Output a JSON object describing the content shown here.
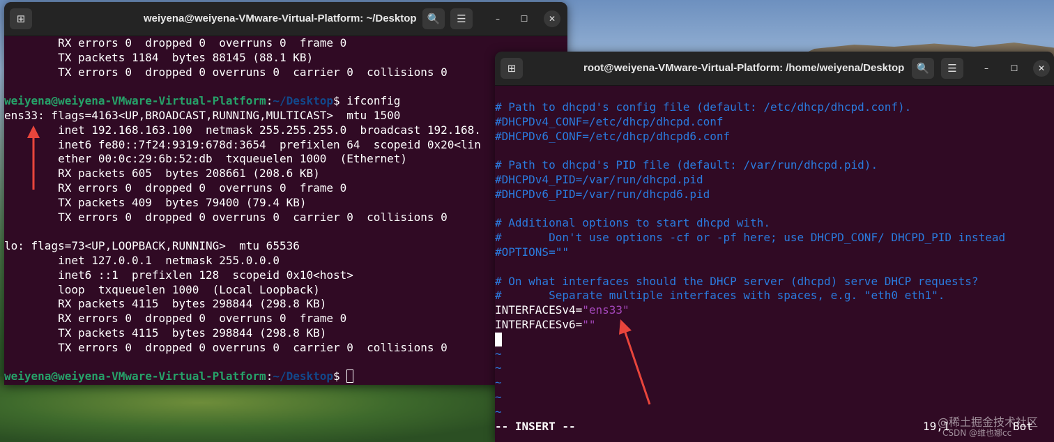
{
  "terminal_left": {
    "title": "weiyena@weiyena-VMware-Virtual-Platform: ~/Desktop",
    "buttons": {
      "new_tab": "⊞",
      "search": "🔍",
      "menu": "☰",
      "minimize": "–",
      "maximize": "☐",
      "close": "✕"
    },
    "lines": [
      "        RX errors 0  dropped 0  overruns 0  frame 0",
      "        TX packets 1184  bytes 88145 (88.1 KB)",
      "        TX errors 0  dropped 0 overruns 0  carrier 0  collisions 0",
      "",
      "__PROMPT1__",
      "ens33: flags=4163<UP,BROADCAST,RUNNING,MULTICAST>  mtu 1500",
      "        inet 192.168.163.100  netmask 255.255.255.0  broadcast 192.168.",
      "        inet6 fe80::7f24:9319:678d:3654  prefixlen 64  scopeid 0x20<lin",
      "        ether 00:0c:29:6b:52:db  txqueuelen 1000  (Ethernet)",
      "        RX packets 605  bytes 208661 (208.6 KB)",
      "        RX errors 0  dropped 0  overruns 0  frame 0",
      "        TX packets 409  bytes 79400 (79.4 KB)",
      "        TX errors 0  dropped 0 overruns 0  carrier 0  collisions 0",
      "",
      "lo: flags=73<UP,LOOPBACK,RUNNING>  mtu 65536",
      "        inet 127.0.0.1  netmask 255.0.0.0",
      "        inet6 ::1  prefixlen 128  scopeid 0x10<host>",
      "        loop  txqueuelen 1000  (Local Loopback)",
      "        RX packets 4115  bytes 298844 (298.8 KB)",
      "        RX errors 0  dropped 0  overruns 0  frame 0",
      "        TX packets 4115  bytes 298844 (298.8 KB)",
      "        TX errors 0  dropped 0 overruns 0  carrier 0  collisions 0"
    ],
    "prompt": {
      "user_host": "weiyena@weiyena-VMware-Virtual-Platform",
      "colon": ":",
      "path": "~/Desktop",
      "dollar": "$",
      "command": " ifconfig"
    }
  },
  "terminal_right": {
    "title": "root@weiyena-VMware-Virtual-Platform: /home/weiyena/Desktop",
    "buttons": {
      "new_tab": "⊞",
      "search": "🔍",
      "menu": "☰",
      "minimize": "–",
      "maximize": "☐",
      "close": "✕"
    },
    "lines": [
      {
        "t": "# Path to dhcpd's config file (default: /etc/dhcp/dhcpd.conf).",
        "c": "cmt"
      },
      {
        "t": "#DHCPDv4_CONF=/etc/dhcp/dhcpd.conf",
        "c": "cmt"
      },
      {
        "t": "#DHCPDv6_CONF=/etc/dhcp/dhcpd6.conf",
        "c": "cmt"
      },
      {
        "t": "",
        "c": ""
      },
      {
        "t": "# Path to dhcpd's PID file (default: /var/run/dhcpd.pid).",
        "c": "cmt"
      },
      {
        "t": "#DHCPDv4_PID=/var/run/dhcpd.pid",
        "c": "cmt"
      },
      {
        "t": "#DHCPDv6_PID=/var/run/dhcpd6.pid",
        "c": "cmt"
      },
      {
        "t": "",
        "c": ""
      },
      {
        "t": "# Additional options to start dhcpd with.",
        "c": "cmt"
      },
      {
        "t": "#       Don't use options -cf or -pf here; use DHCPD_CONF/ DHCPD_PID instead",
        "c": "cmt"
      },
      {
        "t": "#OPTIONS=\"\"",
        "c": "cmt"
      },
      {
        "t": "",
        "c": ""
      },
      {
        "t": "# On what interfaces should the DHCP server (dhcpd) serve DHCP requests?",
        "c": "cmt"
      },
      {
        "t": "#       Separate multiple interfaces with spaces, e.g. \"eth0 eth1\".",
        "c": "cmt"
      }
    ],
    "iface_v4": {
      "key": "INTERFACESv4=",
      "value": "\"ens33\""
    },
    "iface_v6": {
      "key": "INTERFACESv6=",
      "value": "\"\""
    },
    "tildes": [
      "~",
      "~",
      "~",
      "~",
      "~"
    ],
    "mode": "-- INSERT --",
    "position": "19,1",
    "scroll": "Bot"
  },
  "watermark": "@稀土掘金技术社区",
  "watermark2": "CSDN @维也娜cc",
  "colors": {
    "terminal_bg": "#300a24",
    "prompt_user": "#26a269",
    "prompt_path": "#12488b",
    "comment": "#2a7bde",
    "string": "#a347ba",
    "arrow": "#e8453c"
  }
}
